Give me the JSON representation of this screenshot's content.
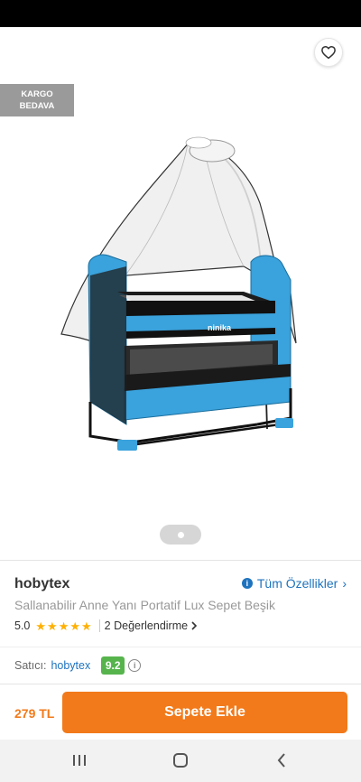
{
  "colors": {
    "accent": "#f27a1a",
    "link": "#1e73be",
    "star": "#ffb000",
    "score_badge": "#57b44d",
    "badge_bg": "#9a9a9a",
    "crib_blue": "#3aa2dc"
  },
  "app_bar": {
    "back_icon": "arrow-left-icon",
    "share_icon": "share-icon",
    "favorite_icon": "heart-outline-icon"
  },
  "badge": {
    "line1": "KARGO",
    "line2": "BEDAVA"
  },
  "gallery": {
    "current_index": 1,
    "count": 1
  },
  "product": {
    "brand": "hobytex",
    "name": "Sallanabilir Anne Yanı Portatif Lux Sepet Beşik",
    "all_features_label": "Tüm Özellikler",
    "rating": "5.0",
    "stars": 5,
    "reviews_label": "2 Değerlendirme"
  },
  "seller": {
    "label": "Satıcı:",
    "name": "hobytex",
    "score": "9.2"
  },
  "purchase": {
    "price": "279 TL",
    "add_to_cart_label": "Sepete Ekle"
  },
  "system_nav": {
    "recents_icon": "recents-icon",
    "home_icon": "home-icon",
    "back_icon": "chevron-left-icon"
  }
}
